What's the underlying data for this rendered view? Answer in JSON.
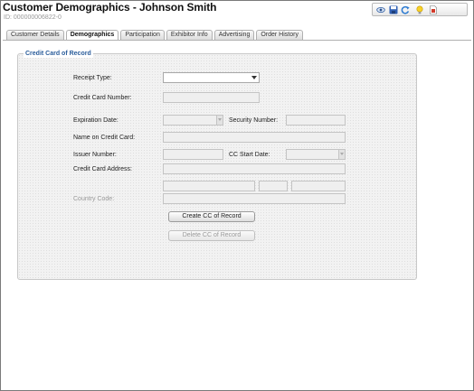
{
  "header": {
    "title": "Customer Demographics - Johnson Smith",
    "id_text": "ID: 000000006822-0"
  },
  "toolbar": {
    "icons": [
      "eye-icon",
      "save-icon",
      "refresh-icon",
      "lightbulb-icon",
      "report-icon"
    ]
  },
  "tabs": [
    {
      "label": "Customer Details",
      "active": false
    },
    {
      "label": "Demographics",
      "active": true
    },
    {
      "label": "Participation",
      "active": false
    },
    {
      "label": "Exhibitor Info",
      "active": false
    },
    {
      "label": "Advertising",
      "active": false
    },
    {
      "label": "Order History",
      "active": false
    }
  ],
  "section": {
    "legend": "Credit Card of Record"
  },
  "form": {
    "receipt_type_label": "Receipt Type:",
    "receipt_type_value": "",
    "cc_number_label": "Credit Card Number:",
    "exp_date_label": "Expiration  Date:",
    "security_number_label": "Security Number:",
    "name_on_card_label": "Name on Credit Card:",
    "issuer_number_label": "Issuer Number:",
    "cc_start_date_label": "CC Start Date:",
    "cc_address_label": "Credit Card Address:",
    "country_code_label": "Country Code:"
  },
  "buttons": {
    "create": "Create CC of Record",
    "delete": "Delete CC of Record"
  },
  "colors": {
    "legend": "#2b5d9b",
    "panel_bg": "#f2f2f2"
  }
}
